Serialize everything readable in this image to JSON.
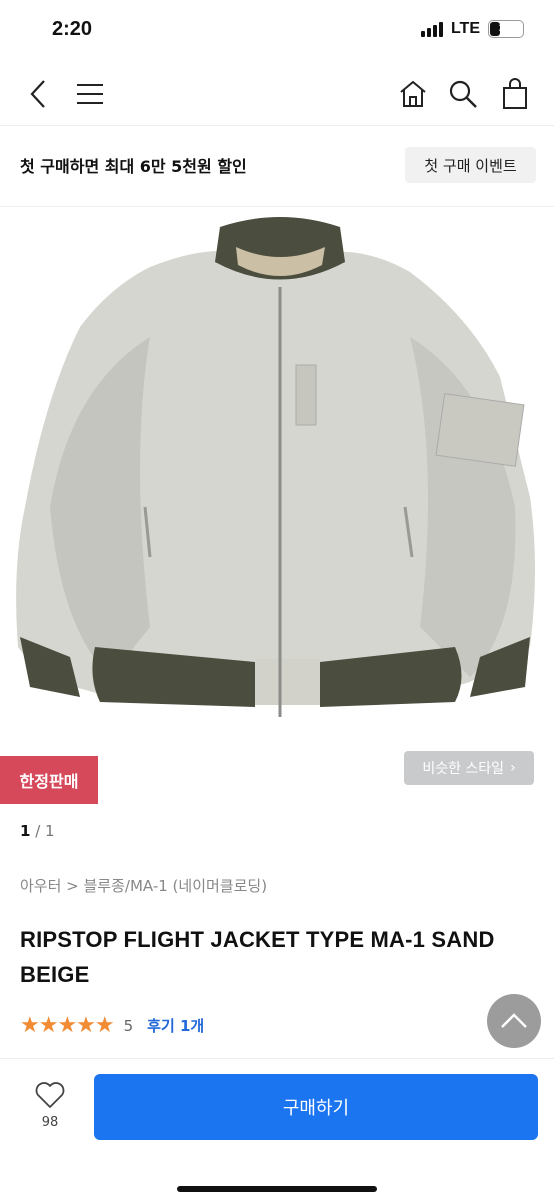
{
  "status": {
    "time": "2:20",
    "network": "LTE",
    "battery": "31",
    "battery_level": 0.31
  },
  "nav": {
    "icons": [
      "back-arrow-icon",
      "menu-icon",
      "home-icon",
      "search-icon",
      "shopping-bag-icon"
    ]
  },
  "promo": {
    "text": "첫 구매하면 최대 6만 5천원 할인",
    "button_label": "첫 구매 이벤트"
  },
  "product": {
    "badge": "한정판매",
    "similar_style_label": "비슷한 스타일",
    "pager_current": "1",
    "pager_total": " / 1",
    "breadcrumb": "아우터 > 블루종/MA-1 (네이머클로딩)",
    "title": "RIPSTOP FLIGHT JACKET TYPE MA-1 SAND BEIGE",
    "stars": "★★★★★",
    "rating": "5",
    "review_label": "후기 1개"
  },
  "bottom": {
    "like_count": "98",
    "buy_label": "구매하기"
  },
  "colors": {
    "accent": "#1b74f0",
    "badge": "#d5495b",
    "star": "#f28c34",
    "review_link": "#2268d8"
  }
}
